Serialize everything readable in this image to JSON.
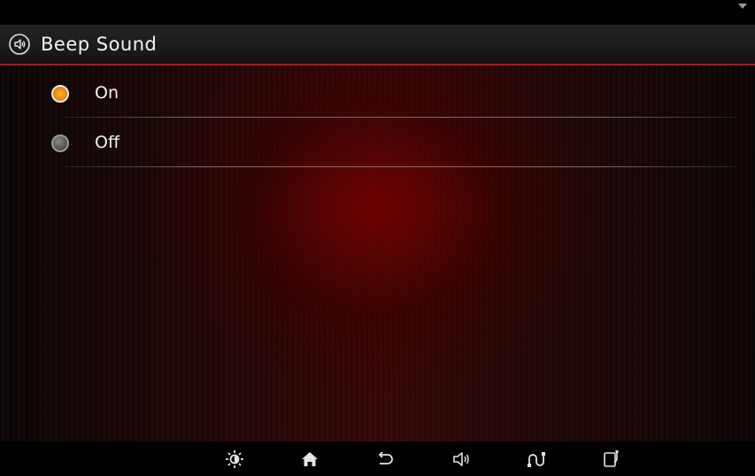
{
  "screen": {
    "title": "Beep Sound",
    "title_icon": "speaker-icon",
    "accent_color": "#b3151a",
    "selected_color": "#f08a10"
  },
  "options": [
    {
      "label": "On",
      "selected": true
    },
    {
      "label": "Off",
      "selected": false
    }
  ],
  "nav_bar": {
    "items": [
      {
        "icon": "moon-icon"
      },
      {
        "icon": "brightness-icon"
      },
      {
        "icon": "home-icon"
      },
      {
        "icon": "back-icon"
      },
      {
        "icon": "volume-icon"
      },
      {
        "icon": "connect-icon"
      },
      {
        "icon": "phone-connect-icon"
      }
    ]
  },
  "status_bar": {
    "icon": "wifi-icon"
  }
}
